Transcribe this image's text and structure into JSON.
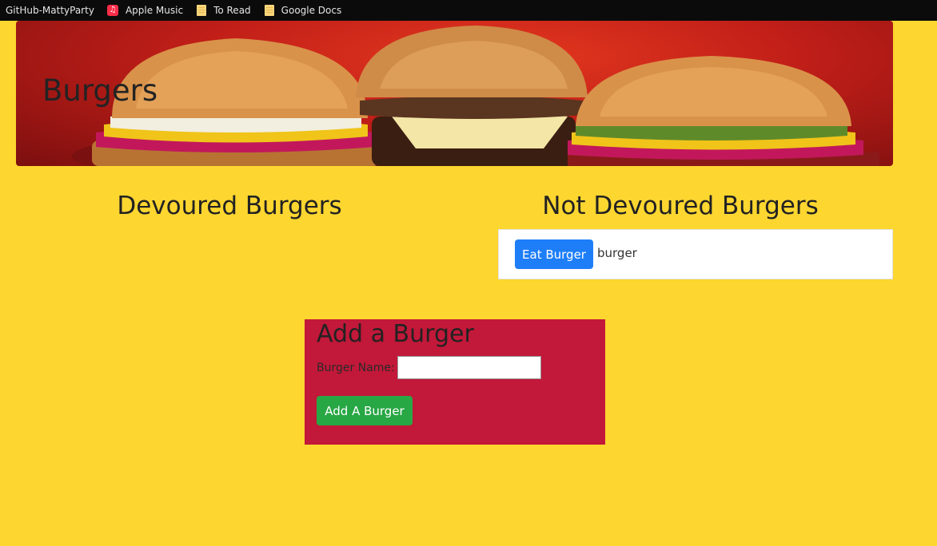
{
  "bookmarks": [
    {
      "label": "GitHub-MattyParty",
      "icon": "none"
    },
    {
      "label": "Apple Music",
      "icon": "apple-music-icon"
    },
    {
      "label": "To Read",
      "icon": "folder-icon"
    },
    {
      "label": "Google Docs",
      "icon": "folder-icon"
    }
  ],
  "banner": {
    "title": "Burgers"
  },
  "columns": {
    "devoured_heading": "Devoured Burgers",
    "not_devoured_heading": "Not Devoured Burgers"
  },
  "not_devoured": [
    {
      "button_label": "Eat Burger",
      "name": "burger"
    }
  ],
  "devoured": [],
  "add_form": {
    "title": "Add a Burger",
    "field_label": "Burger Name:",
    "field_value": "",
    "field_placeholder": "",
    "submit_label": "Add A Burger"
  },
  "colors": {
    "page_background": "#fdd630",
    "form_background": "#c21839",
    "eat_button": "#1e7ef8",
    "add_button": "#28a745"
  }
}
